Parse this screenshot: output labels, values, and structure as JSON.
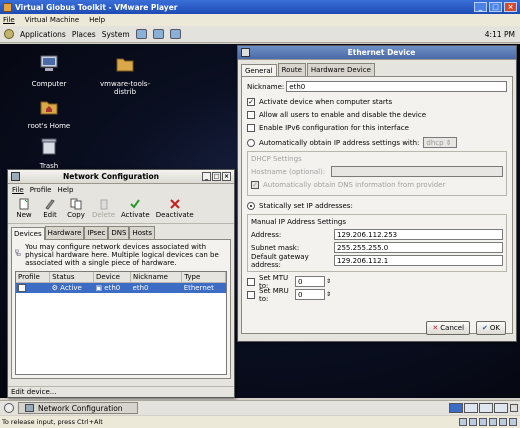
{
  "vmware": {
    "title": "Virtual Globus Toolkit - VMware Player",
    "menu": [
      "File",
      "Virtual Machine",
      "Help"
    ],
    "status": "To release input, press Ctrl+Alt"
  },
  "panel": {
    "items": [
      "Applications",
      "Places",
      "System"
    ],
    "clock": "4:11 PM"
  },
  "desktop": {
    "icons": [
      "Computer",
      "vmware-tools-distrib",
      "root's Home",
      "Trash"
    ]
  },
  "ethernet": {
    "title": "Ethernet Device",
    "tabs": [
      "General",
      "Route",
      "Hardware Device"
    ],
    "nickname_label": "Nickname:",
    "nickname": "eth0",
    "activate_label": "Activate device when computer starts",
    "allow_users_label": "Allow all users to enable and disable the device",
    "ipv6_label": "Enable IPv6 configuration for this interface",
    "auto_label": "Automatically obtain IP address settings with:",
    "auto_value": "dhcp",
    "dhcp_settings": "DHCP Settings",
    "hostname_label": "Hostname (optional):",
    "dns_label": "Automatically obtain DNS information from provider",
    "static_label": "Statically set IP addresses:",
    "manual_label": "Manual IP Address Settings",
    "address_label": "Address:",
    "address": "129.206.112.253",
    "subnet_label": "Subnet mask:",
    "subnet": "255.255.255.0",
    "gateway_label": "Default gateway address:",
    "gateway": "129.206.112.1",
    "mtu_label": "Set MTU to:",
    "mtu": "0",
    "mru_label": "Set MRU to:",
    "mru": "0",
    "cancel": "Cancel",
    "ok": "OK"
  },
  "network": {
    "title": "Network Configuration",
    "menu": [
      "File",
      "Profile",
      "Help"
    ],
    "toolbar": [
      "New",
      "Edit",
      "Copy",
      "Delete",
      "Activate",
      "Deactivate"
    ],
    "tabs": [
      "Devices",
      "Hardware",
      "IPsec",
      "DNS",
      "Hosts"
    ],
    "info": "You may configure network devices associated with physical hardware here.  Multiple logical devices can be associated with a single piece of hardware.",
    "columns": [
      "Profile",
      "Status",
      "Device",
      "Nickname",
      "Type"
    ],
    "rows": [
      {
        "status": "Active",
        "device": "eth0",
        "nickname": "eth0",
        "type": "Ethernet"
      }
    ],
    "status": "Edit device..."
  },
  "taskbar": {
    "item": "Network Configuration"
  }
}
